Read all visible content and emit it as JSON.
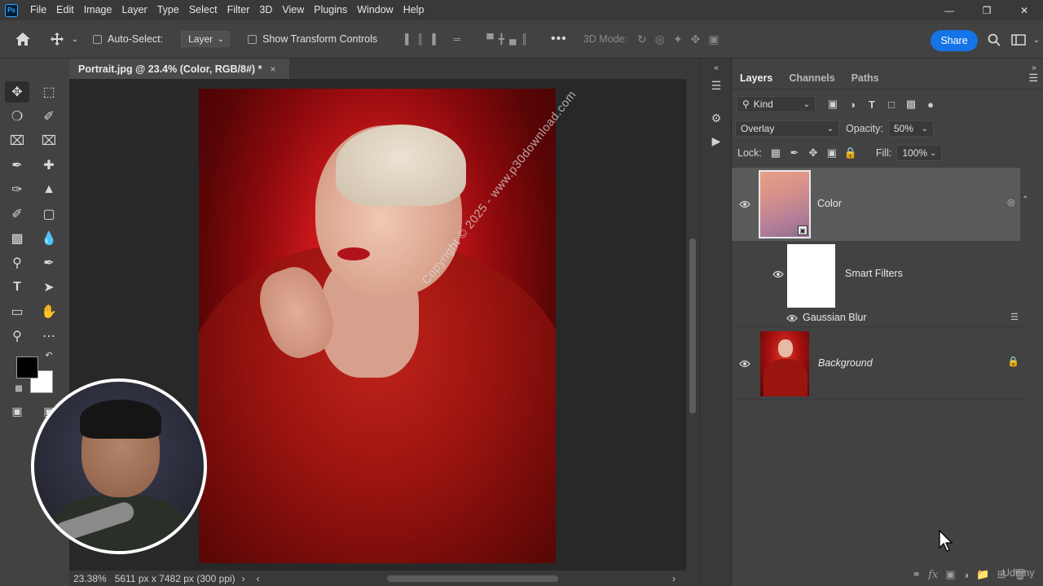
{
  "menu": [
    "File",
    "Edit",
    "Image",
    "Layer",
    "Type",
    "Select",
    "Filter",
    "3D",
    "View",
    "Plugins",
    "Window",
    "Help"
  ],
  "app_logo": "Ps",
  "options": {
    "auto_select_label": "Auto-Select:",
    "auto_select_target": "Layer",
    "show_transform_label": "Show Transform Controls",
    "three_d_mode_label": "3D Mode:",
    "share_label": "Share"
  },
  "document": {
    "tab_title": "Portrait.jpg @ 23.4% (Color, RGB/8#) *",
    "close_glyph": "×",
    "zoom": "23.38%",
    "dimensions": "5611 px x 7482 px (300 ppi)",
    "watermark": "Copyright © 2025 - www.p30download.com"
  },
  "layers_panel": {
    "tabs": [
      "Layers",
      "Channels",
      "Paths"
    ],
    "active_tab": "Layers",
    "filter_kind": "Kind",
    "blend_mode": "Overlay",
    "opacity_label": "Opacity:",
    "opacity_value": "50%",
    "lock_label": "Lock:",
    "fill_label": "Fill:",
    "fill_value": "100%",
    "layers": [
      {
        "name": "Color",
        "type": "smart-object",
        "selected": true
      },
      {
        "name": "Smart Filters",
        "type": "filter-mask"
      },
      {
        "name": "Gaussian Blur",
        "type": "filter"
      },
      {
        "name": "Background",
        "type": "background",
        "locked": true
      }
    ]
  },
  "colors": {
    "accent": "#1473e6",
    "foreground": "#000000",
    "background": "#ffffff"
  },
  "watermark_footer": "Udemy"
}
